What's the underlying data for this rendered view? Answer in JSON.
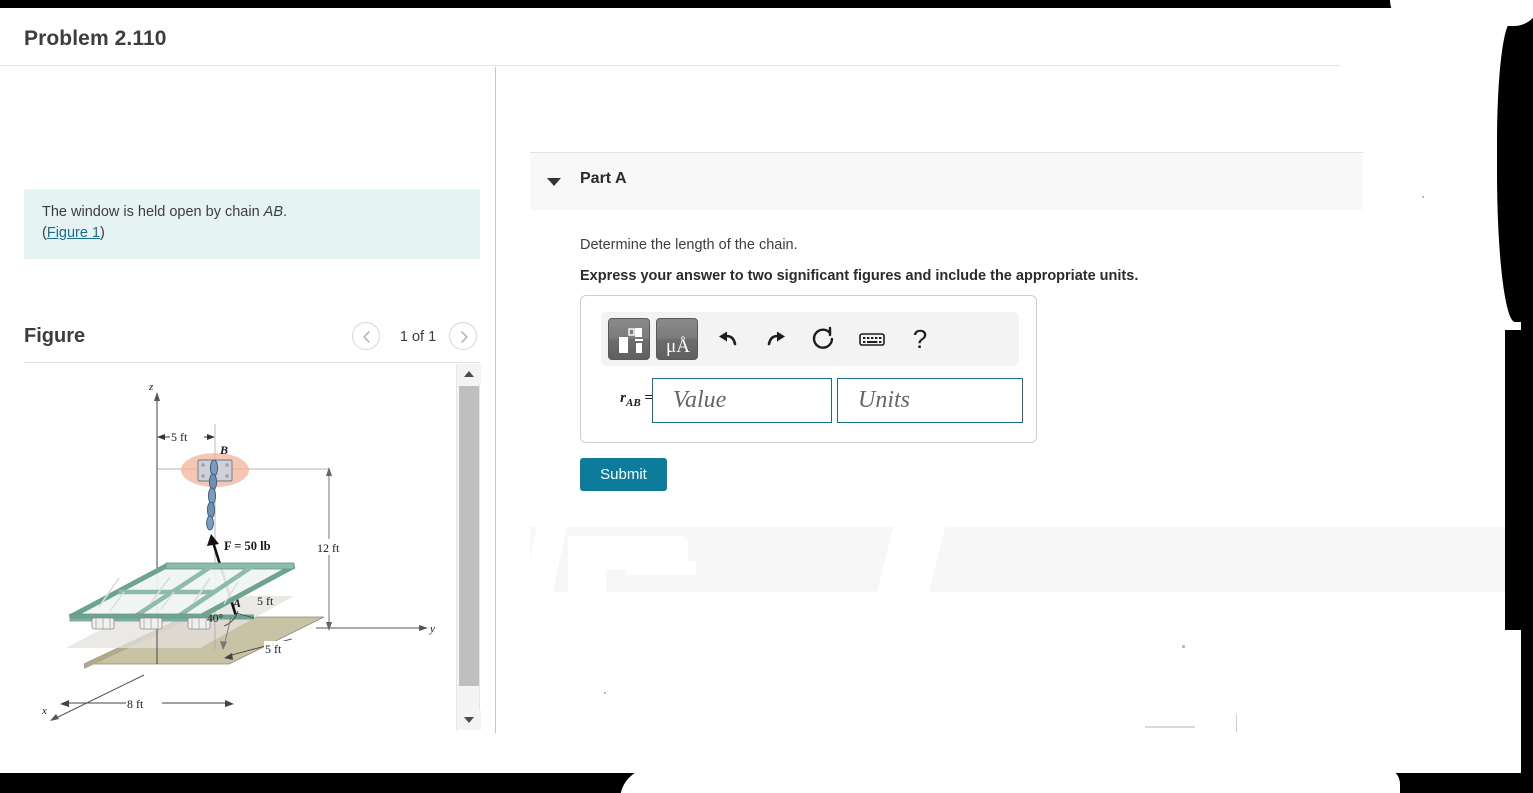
{
  "header": {
    "problem_title": "Problem 2.110"
  },
  "left_pane": {
    "statement": {
      "text_before": "The window is held open by chain ",
      "variable": "AB",
      "text_after": ".",
      "paren_open": "(",
      "figure_link": "Figure 1",
      "paren_close": ")"
    },
    "figure_section": {
      "label": "Figure",
      "counter": "1 of 1",
      "prev_icon": "chevron-left-icon",
      "next_icon": "chevron-right-icon"
    },
    "figure": {
      "axis_z": "z",
      "axis_y": "y",
      "axis_x": "x",
      "point_a": "A",
      "point_b": "B",
      "dim_top": "5 ft",
      "dim_height": "12 ft",
      "dim_window": "5 ft",
      "dim_depth": "5 ft",
      "dim_width": "8 ft",
      "angle": "40°",
      "force_label": "F = 50 lb",
      "colors": {
        "frame": "#8ebcab",
        "frame_dark": "#6ea391",
        "glass": "#f2f6f5",
        "ground": "#c9c3a6",
        "ground_dark": "#b0a98a",
        "chain": "#5b7fa6",
        "bracket": "#c9cdd4",
        "highlight": "#f2b49a"
      }
    },
    "scrollbar": {
      "up_icon": "triangle-up-icon",
      "down_icon": "triangle-down-icon"
    }
  },
  "right_pane": {
    "part": {
      "caret_icon": "caret-down-icon",
      "title": "Part A"
    },
    "question": "Determine the length of the chain.",
    "instruction": "Express your answer to two significant figures and include the appropriate units.",
    "toolbar": {
      "template_button": "math-template-icon",
      "units_button": "μÅ",
      "undo": "undo-arrow-icon",
      "redo": "redo-arrow-icon",
      "reset": "reset-circle-icon",
      "keyboard": "keyboard-icon",
      "help": "?"
    },
    "answer": {
      "variable": "r",
      "subscript": "AB",
      "equals": "=",
      "value_placeholder": "Value",
      "value": "",
      "units_placeholder": "Units",
      "units": ""
    },
    "submit_label": "Submit"
  },
  "colors": {
    "accent": "#0d7b9c",
    "statement_bg": "#e5f3f3",
    "part_header_bg": "#f8f8f8",
    "divider": "#b5cdda",
    "field_border": "#1c6e85",
    "footer_bg": "#f7f7f7"
  }
}
